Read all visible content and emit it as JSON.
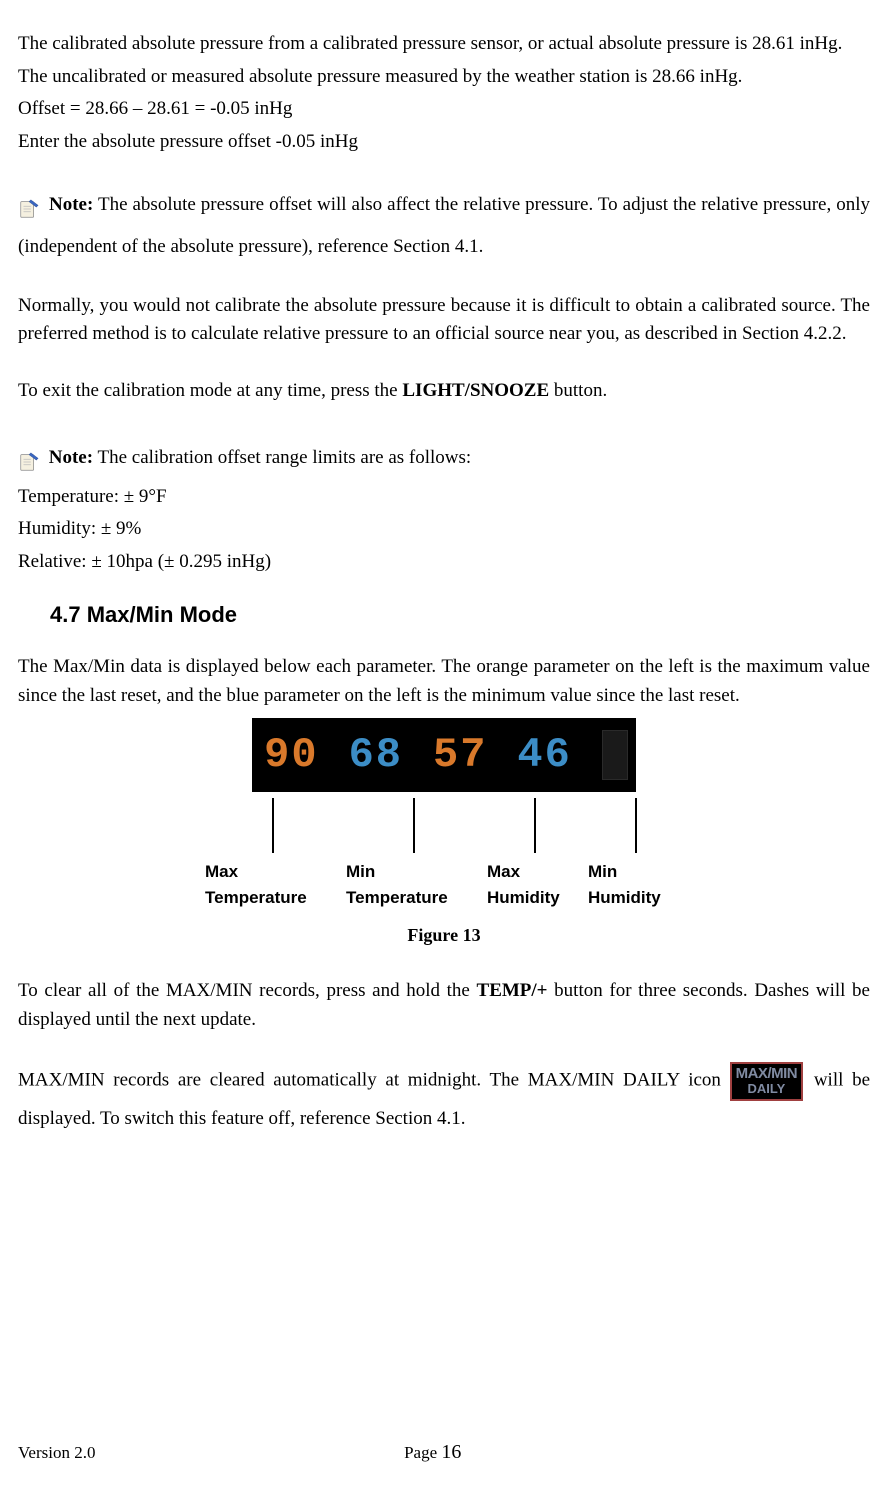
{
  "p1": "The calibrated absolute pressure from a calibrated pressure sensor, or actual absolute pressure is 28.61 inHg.",
  "p2": "The uncalibrated or measured absolute pressure measured by the weather station is 28.66 inHg.",
  "p3": "Offset = 28.66 – 28.61 = -0.05 inHg",
  "p4": "Enter the absolute pressure offset -0.05 inHg",
  "note1_label": "Note:",
  "note1_text": " The absolute pressure offset will also affect the relative pressure. To adjust the relative pressure, only (independent of the absolute pressure), reference Section 4.1.",
  "p5": "Normally, you would not calibrate the absolute pressure because it is difficult to obtain a calibrated source. The preferred method is to calculate relative pressure to an official source near you, as described in Section 4.2.2.",
  "p6_before": "To exit the calibration mode at any time, press the ",
  "p6_bold": "LIGHT/SNOOZE",
  "p6_after": " button.",
  "note2_label": "Note:",
  "note2_text": " The calibration offset range limits are as follows:",
  "limit1": "Temperature: ± 9°F",
  "limit2": "Humidity: ± 9%",
  "limit3": "Relative: ± 10hpa (± 0.295 inHg)",
  "heading": "4.7 Max/Min Mode",
  "p7": "The Max/Min data is displayed below each parameter. The orange parameter on the left is the maximum value since the last reset, and the blue parameter on the left is the minimum value since the last reset.",
  "display": {
    "max_temp": "90",
    "min_temp": "68",
    "max_hum": "57",
    "min_hum": "46"
  },
  "labels": {
    "l1a": "Max",
    "l1b": "Temperature",
    "l2a": "Min",
    "l2b": "Temperature",
    "l3a": "Max",
    "l3b": "Humidity",
    "l4a": "Min",
    "l4b": "Humidity"
  },
  "figure_caption": "Figure 13",
  "p8_before": "To clear all of the MAX/MIN records, press and hold the ",
  "p8_bold": "TEMP/+",
  "p8_after": " button for three seconds. Dashes will be displayed until the next update.",
  "p9a": "MAX/MIN records are cleared automatically at midnight. The MAX/MIN DAILY icon ",
  "p9b": " will be displayed. To switch this feature off, reference Section 4.1.",
  "maxmin_icon_top": "MAX/MIN",
  "maxmin_icon_bot": "DAILY",
  "footer_version": "Version 2.0",
  "footer_page_label": "Page ",
  "footer_page_num": "16",
  "chart_data": {
    "type": "table",
    "title": "Max/Min Display Values",
    "series": [
      {
        "name": "Max Temperature",
        "values": [
          90
        ],
        "color_semantic": "orange"
      },
      {
        "name": "Min Temperature",
        "values": [
          68
        ],
        "color_semantic": "blue"
      },
      {
        "name": "Max Humidity",
        "values": [
          57
        ],
        "color_semantic": "orange"
      },
      {
        "name": "Min Humidity",
        "values": [
          46
        ],
        "color_semantic": "blue"
      }
    ]
  }
}
